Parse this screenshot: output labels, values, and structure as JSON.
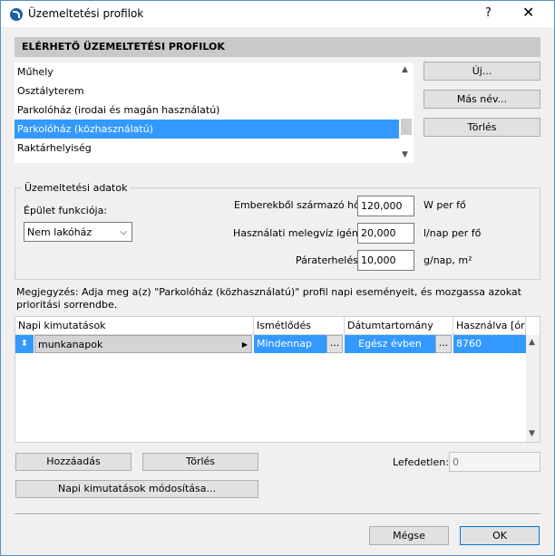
{
  "window": {
    "title": "Üzemeltetési profilok",
    "help": "?",
    "close": "✕"
  },
  "profiles": {
    "header": "ELÉRHETŐ ÜZEMELTETÉSI PROFILOK",
    "items": [
      "Műhely",
      "Osztályterem",
      "Parkolóház (irodai és magán használatú)",
      "Parkolóház (közhasználatú)",
      "Raktárhelyiség"
    ],
    "selected_index": 3,
    "buttons": {
      "new": "Új...",
      "rename": "Más név...",
      "delete": "Törlés"
    }
  },
  "operation": {
    "title": "Üzemeltetési adatok",
    "function_label": "Épület funkciója:",
    "function_value": "Nem lakóház",
    "heat_label": "Emberekből származó hő:",
    "heat_value": "120,000",
    "heat_unit": "W per fő",
    "water_label": "Használati melegvíz igény:",
    "water_value": "20,000",
    "water_unit": "l/nap per fő",
    "vapor_label": "Páraterhelés:",
    "vapor_value": "10,000",
    "vapor_unit": "g/nap, m²"
  },
  "note": "Megjegyzés: Adja meg a(z) \"Parkolóház (közhasználatú)\" profil napi eseményeit, és mozgassa azokat prioritási sorrendbe.",
  "schedule_table": {
    "columns": [
      "Napi kimutatások",
      "Ismétlődés",
      "Dátumtartomány",
      "Használva [óra]"
    ],
    "rows": [
      {
        "name": "munkanapok",
        "repeat": "Mindennap",
        "range": "Egész évben",
        "hours": "8760"
      }
    ],
    "ellipsis": "..."
  },
  "actions": {
    "add": "Hozzáadás",
    "delete": "Törlés",
    "modify": "Napi kimutatások módosítása...",
    "uncovered_label": "Lefedetlen:",
    "uncovered_value": "0",
    "cancel": "Mégse",
    "ok": "OK"
  },
  "colors": {
    "selection": "#3399ff",
    "ok_border": "#0078d7"
  }
}
